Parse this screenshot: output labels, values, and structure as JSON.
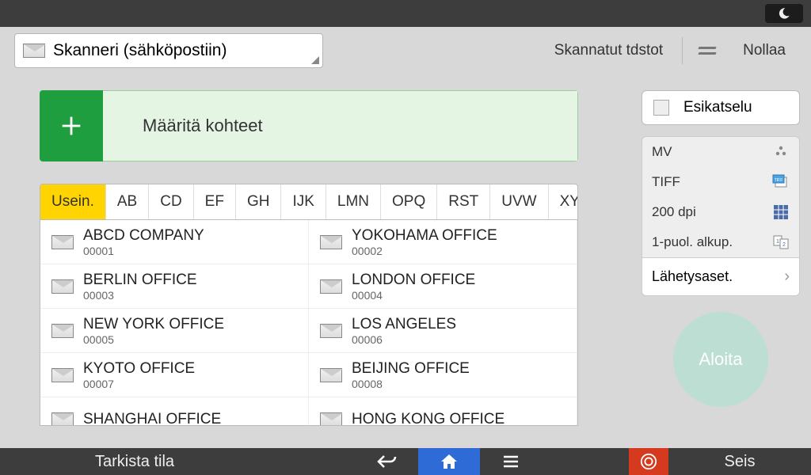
{
  "header": {
    "mode_label": "Skanneri (sähköpostiin)",
    "scanned_files": "Skannatut tdstot",
    "reset": "Nollaa"
  },
  "destinations": {
    "banner_label": "Määritä kohteet"
  },
  "tabs": [
    "Usein.",
    "AB",
    "CD",
    "EF",
    "GH",
    "IJK",
    "LMN",
    "OPQ",
    "RST",
    "UVW",
    "XYZ"
  ],
  "active_tab": 0,
  "contacts": [
    {
      "name": "ABCD COMPANY",
      "code": "00001"
    },
    {
      "name": "YOKOHAMA OFFICE",
      "code": "00002"
    },
    {
      "name": "BERLIN OFFICE",
      "code": "00003"
    },
    {
      "name": "LONDON OFFICE",
      "code": "00004"
    },
    {
      "name": "NEW YORK OFFICE",
      "code": "00005"
    },
    {
      "name": "LOS ANGELES",
      "code": "00006"
    },
    {
      "name": "KYOTO OFFICE",
      "code": "00007"
    },
    {
      "name": "BEIJING OFFICE",
      "code": "00008"
    },
    {
      "name": "SHANGHAI  OFFICE",
      "code": ""
    },
    {
      "name": "HONG KONG OFFICE",
      "code": ""
    }
  ],
  "side": {
    "preview": "Esikatselu",
    "rows": [
      {
        "label": "MV",
        "icon": "dots"
      },
      {
        "label": "TIFF",
        "icon": "tiff"
      },
      {
        "label": "200 dpi",
        "icon": "grid"
      },
      {
        "label": "1-puol. alkup.",
        "icon": "pages"
      }
    ],
    "send_settings": "Lähetysaset.",
    "start": "Aloita"
  },
  "bottom": {
    "status": "Tarkista tila",
    "stop": "Seis"
  }
}
